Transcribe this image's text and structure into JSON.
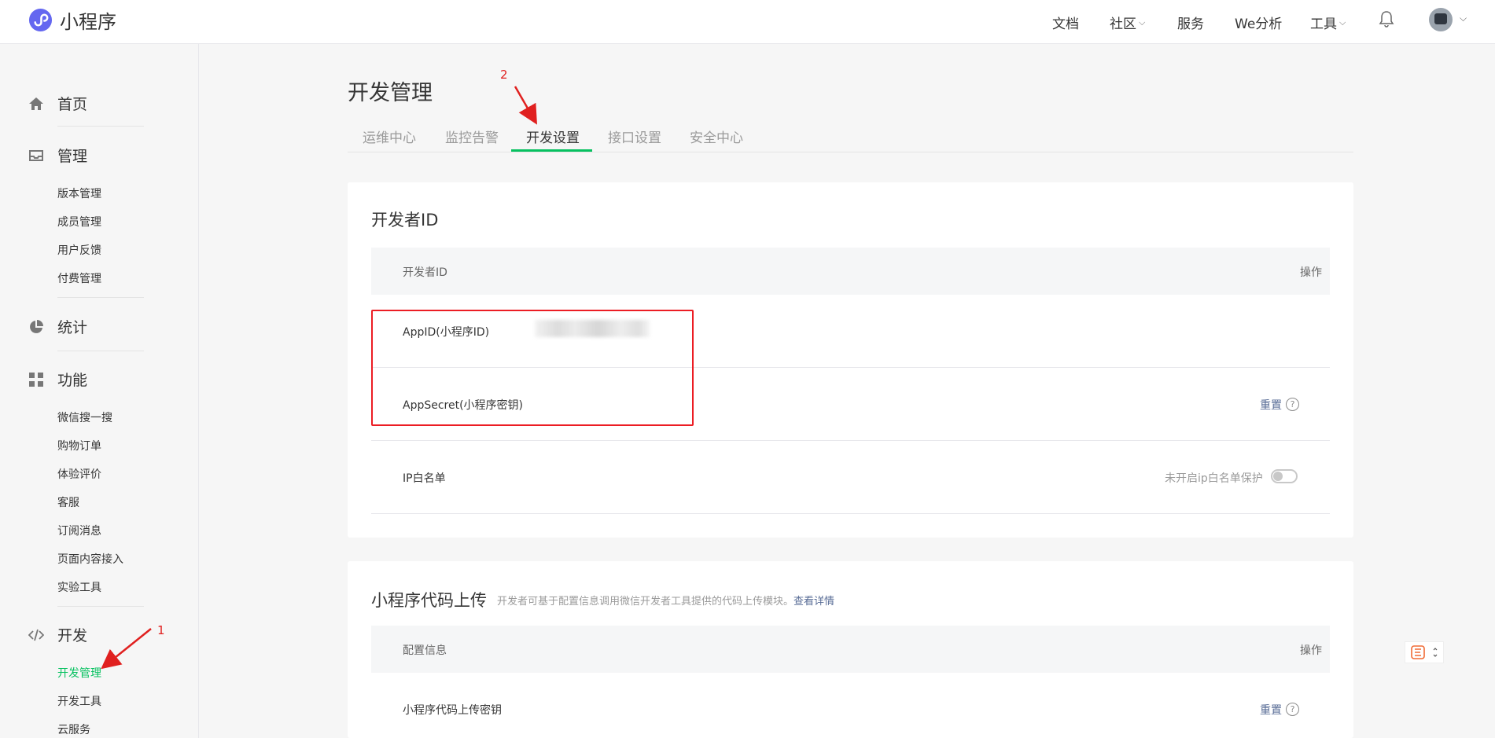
{
  "brand": {
    "name": "小程序",
    "accent": "#07c160",
    "link_color": "#576b95"
  },
  "topnav": {
    "docs": "文档",
    "community": "社区",
    "service": "服务",
    "analytics": "We分析",
    "tools": "工具"
  },
  "sidebar": {
    "home": "首页",
    "manage": {
      "label": "管理",
      "items": [
        "版本管理",
        "成员管理",
        "用户反馈",
        "付费管理"
      ]
    },
    "stats": "统计",
    "features": {
      "label": "功能",
      "items": [
        "微信搜一搜",
        "购物订单",
        "体验评价",
        "客服",
        "订阅消息",
        "页面内容接入",
        "实验工具"
      ]
    },
    "dev": {
      "label": "开发",
      "items": [
        "开发管理",
        "开发工具",
        "云服务"
      ]
    }
  },
  "main": {
    "title": "开发管理",
    "tabs": [
      "运维中心",
      "监控告警",
      "开发设置",
      "接口设置",
      "安全中心"
    ],
    "active_tab": "开发设置"
  },
  "developer_id": {
    "title": "开发者ID",
    "col_name": "开发者ID",
    "col_action": "操作",
    "appid_label": "AppID(小程序ID)",
    "appsecret_label": "AppSecret(小程序密钥)",
    "appsecret_action": "重置",
    "ip_label": "IP白名单",
    "ip_status": "未开启ip白名单保护",
    "ip_toggle_on": false
  },
  "code_upload": {
    "title": "小程序代码上传",
    "desc": "开发者可基于配置信息调用微信开发者工具提供的代码上传模块。",
    "more_link": "查看详情",
    "col_name": "配置信息",
    "col_action": "操作",
    "key_label": "小程序代码上传密钥",
    "key_action": "重置"
  },
  "annotations": {
    "arrow1": "1",
    "arrow2": "2"
  }
}
